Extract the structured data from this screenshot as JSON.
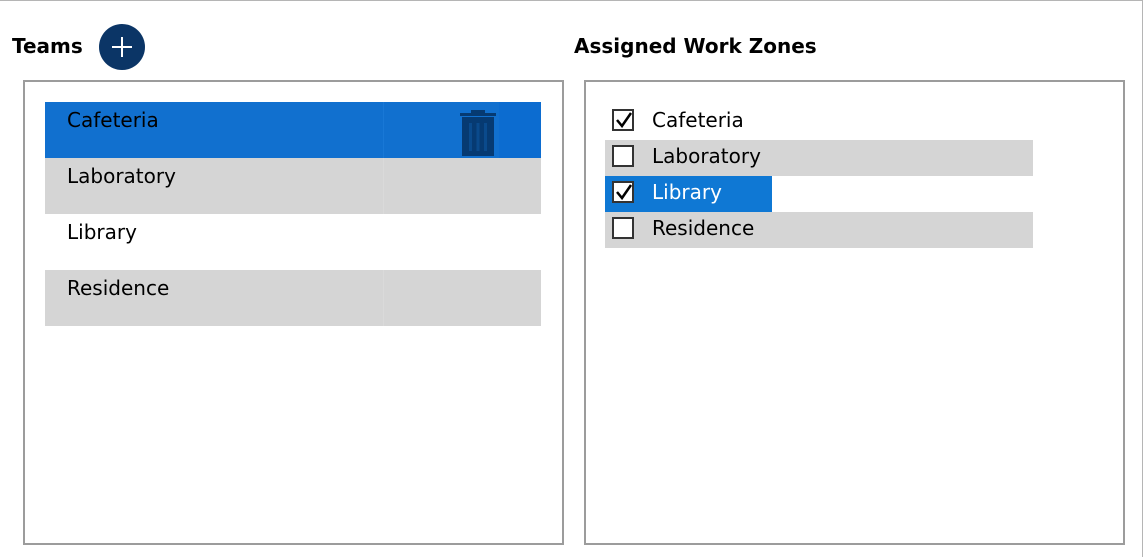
{
  "teams": {
    "title": "Teams",
    "add_icon": "plus-circle-icon",
    "delete_icon": "trash-icon",
    "items": [
      {
        "label": "Cafeteria",
        "state": "selected"
      },
      {
        "label": "Laboratory",
        "state": "normal"
      },
      {
        "label": "Library",
        "state": "normal"
      },
      {
        "label": "Residence",
        "state": "normal"
      }
    ]
  },
  "zones": {
    "title": "Assigned Work Zones",
    "items": [
      {
        "label": "Cafeteria",
        "checked": true
      },
      {
        "label": "Laboratory",
        "checked": false
      },
      {
        "label": "Library",
        "checked": true,
        "focused": true
      },
      {
        "label": "Residence",
        "checked": false
      }
    ]
  },
  "colors": {
    "accent": "#1170cf",
    "add_button": "#0b3566",
    "row_gray": "#d5d5d5"
  }
}
